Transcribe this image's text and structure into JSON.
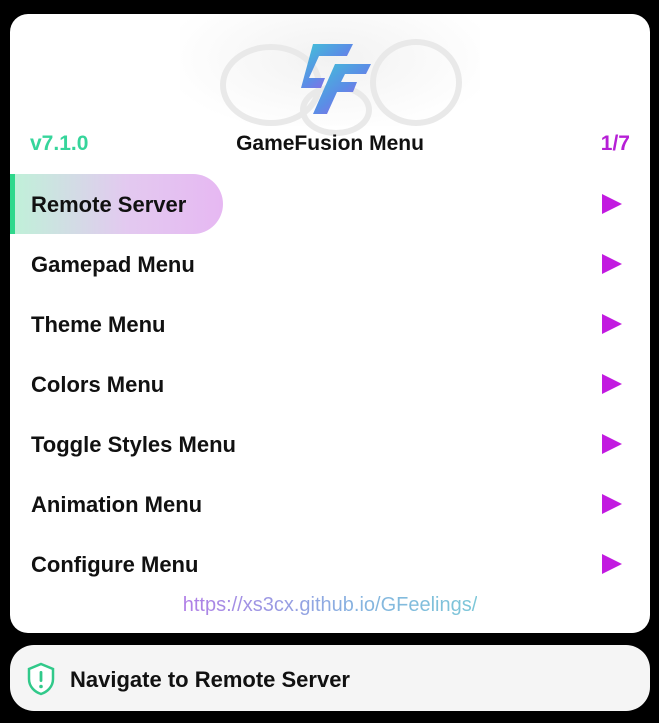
{
  "header": {
    "version": "v7.1.0",
    "title": "GameFusion Menu",
    "page_indicator": "1/7"
  },
  "menu": {
    "selected_index": 0,
    "items": [
      {
        "label": "Remote Server"
      },
      {
        "label": "Gamepad Menu"
      },
      {
        "label": "Theme Menu"
      },
      {
        "label": "Colors Menu"
      },
      {
        "label": "Toggle Styles Menu"
      },
      {
        "label": "Animation Menu"
      },
      {
        "label": "Configure Menu"
      }
    ]
  },
  "footer": {
    "link": "https://xs3cx.github.io/GFeelings/"
  },
  "toast": {
    "message": "Navigate to Remote Server",
    "icon": "shield-alert-icon"
  },
  "colors": {
    "version": "#36d59b",
    "page_indicator": "#b61fd6",
    "arrow": "#c21be0",
    "selected_bar": "#2fd88c"
  },
  "logo": {
    "icon": "gamefusion-logo"
  }
}
